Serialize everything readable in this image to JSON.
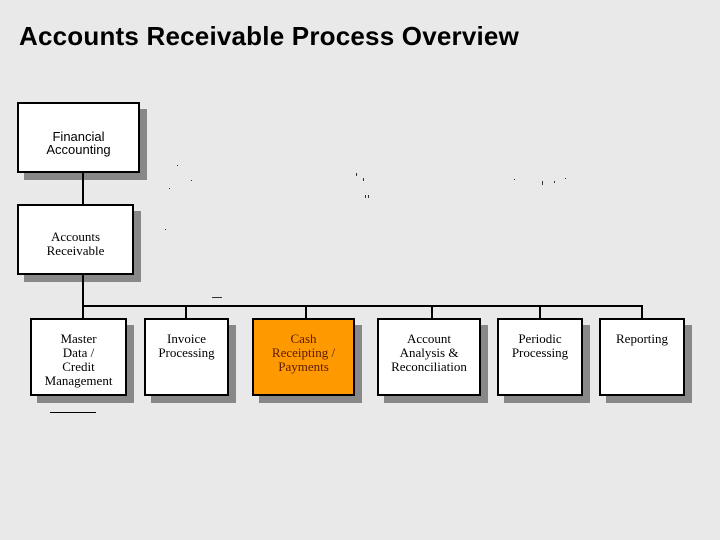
{
  "title": "Accounts Receivable Process Overview",
  "colors": {
    "background": "#e9e9e9",
    "highlight": "#ff9900",
    "shadow": "#888888"
  },
  "nodes": {
    "financial_accounting": {
      "line1": "Financial",
      "line2": "Accounting"
    },
    "accounts_receivable": {
      "line1": "Accounts",
      "line2": "Receivable"
    },
    "children": [
      {
        "lines": [
          "Master",
          "Data /",
          "Credit",
          "Management"
        ]
      },
      {
        "lines": [
          "Invoice",
          "Processing"
        ]
      },
      {
        "lines": [
          "Cash",
          "Receipting /",
          "Payments"
        ],
        "highlighted": true
      },
      {
        "lines": [
          "Account",
          "Analysis &",
          "Reconciliation"
        ]
      },
      {
        "lines": [
          "Periodic",
          "Processing"
        ]
      },
      {
        "lines": [
          "Reporting"
        ]
      }
    ]
  }
}
